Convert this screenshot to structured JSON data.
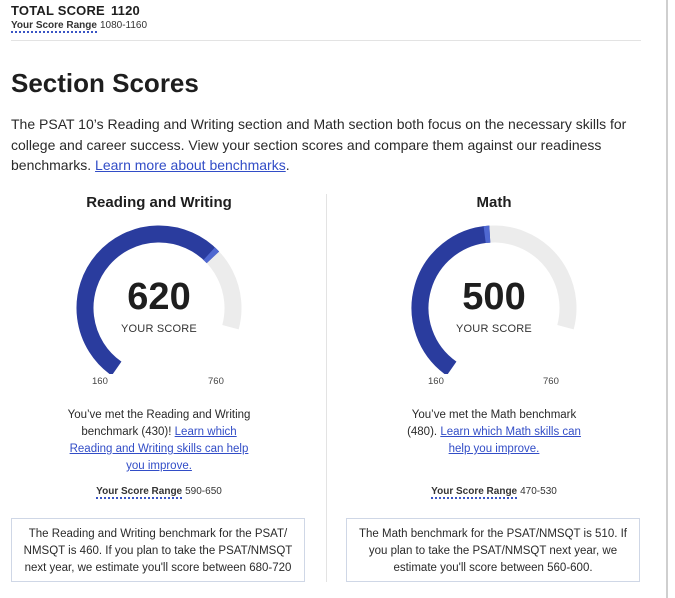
{
  "summary": {
    "total_label": "TOTAL SCORE",
    "total_value": "1120",
    "range_label": "Your Score Range",
    "range_value": "1080-1160"
  },
  "header": {
    "title": "Section Scores",
    "intro": "The PSAT 10’s Reading and Writing section and Math section both focus on the necessary skills for college and career success. View your section scores and compare them against our readiness benchmarks. ",
    "intro_link": "Learn more about benchmarks",
    "intro_end": "."
  },
  "sections": [
    {
      "title": "Reading and Writing",
      "score": 620,
      "score_label": "YOUR SCORE",
      "min": 160,
      "max": 760,
      "score_fraction": 0.767,
      "message": "You’ve met the Reading and Writing benchmark (430)! ",
      "link": "Learn which Reading and Writing skills can help you improve.",
      "range_label": "Your Score Range",
      "range_value": "590-650",
      "note": "The Reading and Writing benchmark for the PSAT/ NMSQT is 460. If you plan to take the PSAT/NMSQT next year, we estimate you'll score between 680-720"
    },
    {
      "title": "Math",
      "score": 500,
      "score_label": "YOUR SCORE",
      "min": 160,
      "max": 760,
      "score_fraction": 0.567,
      "message": "You’ve met the Math benchmark (480). ",
      "link": "Learn which Math skills can help you improve.",
      "range_label": "Your Score Range",
      "range_value": "470-530",
      "note": "The Math benchmark for the PSAT/NMSQT is 510. If you plan to take the PSAT/NMSQT next year, we estimate you'll score between 560-600."
    }
  ],
  "colors": {
    "gauge_fill": "#2a3c9e",
    "gauge_marker": "#4f68d1",
    "gauge_track": "#ececec",
    "link": "#324dc7"
  }
}
